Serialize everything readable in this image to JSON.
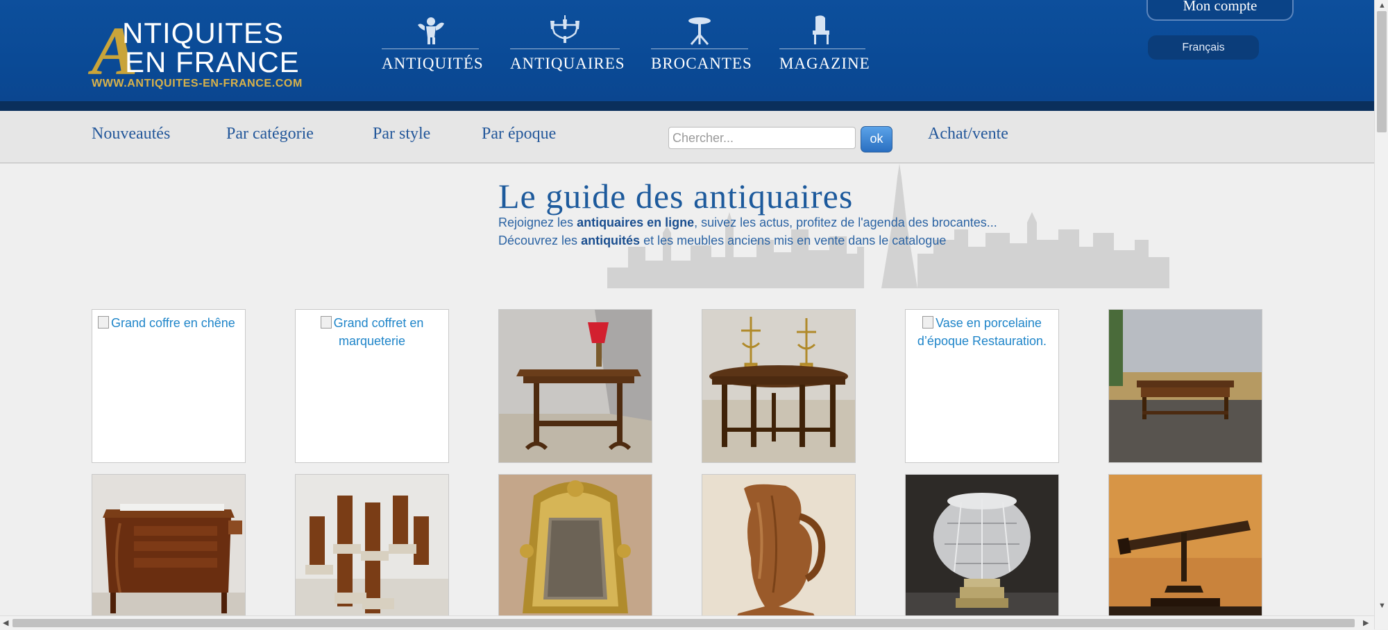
{
  "logo": {
    "initial": "A",
    "line1": "NTIQUITES",
    "line2": "EN FRANCE",
    "url": "WWW.ANTIQUITES-EN-FRANCE.COM"
  },
  "main_nav": [
    {
      "label": "ANTIQUITÉS",
      "icon": "cherub-icon"
    },
    {
      "label": "ANTIQUAIRES",
      "icon": "chandelier-icon"
    },
    {
      "label": "BROCANTES",
      "icon": "table-icon"
    },
    {
      "label": "MAGAZINE",
      "icon": "chair-icon"
    }
  ],
  "account": {
    "label": "Mon compte"
  },
  "language": {
    "label": "Français"
  },
  "sub_nav": [
    "Nouveautés",
    "Par catégorie",
    "Par style",
    "Par époque",
    "Achat/vente"
  ],
  "search": {
    "placeholder": "Chercher...",
    "button": "ok"
  },
  "guide": {
    "title": "Le guide des antiquaires",
    "line1_pre": "Rejoignez les ",
    "line1_bold": "antiquaires en ligne",
    "line1_post": ", suivez les actus, profitez de l'agenda des brocantes...",
    "line2_pre": "Découvrez les ",
    "line2_bold": "antiquités",
    "line2_post": " et les meubles anciens mis en vente dans le catalogue"
  },
  "products": [
    {
      "alt": "Grand coffre en chêne",
      "broken": true
    },
    {
      "alt": "Grand coffret en marqueterie",
      "broken": true
    },
    {
      "alt": "",
      "picture": "walnut-side-table-with-lamp"
    },
    {
      "alt": "",
      "picture": "oval-oak-table-with-candelabra"
    },
    {
      "alt": "Vase en porcelaine d’époque Restauration.",
      "broken": true
    },
    {
      "alt": "",
      "picture": "low-table-in-landscape"
    },
    {
      "alt": "",
      "picture": "mahogany-demilune-console"
    },
    {
      "alt": "",
      "picture": "set-of-art-deco-chairs"
    },
    {
      "alt": "",
      "picture": "gilded-mirror"
    },
    {
      "alt": "",
      "picture": "carved-wood-pitcher"
    },
    {
      "alt": "",
      "picture": "crystal-vase"
    },
    {
      "alt": "",
      "picture": "brass-telescope"
    }
  ],
  "colors": {
    "header_blue": "#0d4f9c",
    "link_blue": "#23579a",
    "gold": "#c9a43a"
  }
}
